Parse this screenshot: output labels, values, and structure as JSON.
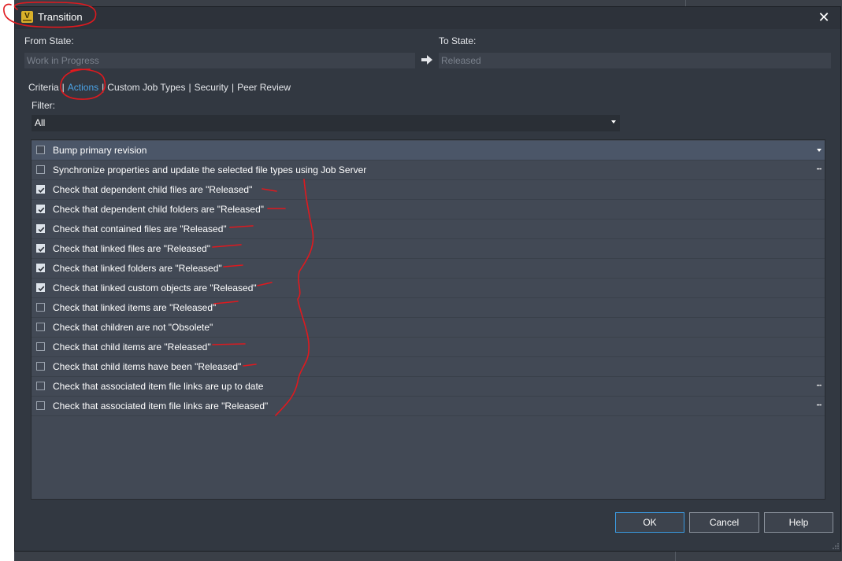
{
  "dialog": {
    "title": "Transition",
    "from_state_label": "From State:",
    "from_state_value": "Work in Progress",
    "to_state_label": "To State:",
    "to_state_value": "Released"
  },
  "tabs": [
    {
      "label": "Criteria",
      "active": false
    },
    {
      "label": "Actions",
      "active": true
    },
    {
      "label": "Custom Job Types",
      "active": false
    },
    {
      "label": "Security",
      "active": false
    },
    {
      "label": "Peer Review",
      "active": false
    }
  ],
  "filter": {
    "label": "Filter:",
    "value": "All"
  },
  "actions": [
    {
      "label": "Bump primary revision",
      "checked": false
    },
    {
      "label": "Synchronize properties and update the selected file types using Job Server",
      "checked": false
    },
    {
      "label": "Check that dependent child files are \"Released\"",
      "checked": true
    },
    {
      "label": "Check that dependent child folders are \"Released\"",
      "checked": true
    },
    {
      "label": "Check that contained files are \"Released\"",
      "checked": true
    },
    {
      "label": "Check that linked files are \"Released\"",
      "checked": true
    },
    {
      "label": "Check that linked folders are \"Released\"",
      "checked": true
    },
    {
      "label": "Check that linked custom objects are \"Released\"",
      "checked": true
    },
    {
      "label": "Check that linked items are \"Released\"",
      "checked": false
    },
    {
      "label": "Check that children are not \"Obsolete\"",
      "checked": false
    },
    {
      "label": "Check that child items are \"Released\"",
      "checked": false
    },
    {
      "label": "Check that child items have been \"Released\"",
      "checked": false
    },
    {
      "label": "Check that associated item file links are up to date",
      "checked": false
    },
    {
      "label": "Check that associated item file links are \"Released\"",
      "checked": false
    }
  ],
  "buttons": {
    "ok": "OK",
    "cancel": "Cancel",
    "help": "Help"
  },
  "icons": {
    "app": "vault-app-icon",
    "close": "close-icon",
    "arrow": "right-arrow-icon"
  },
  "colors": {
    "active_tab": "#4ba3e6",
    "annotation": "#e0191e",
    "dialog_bg": "#323841"
  }
}
